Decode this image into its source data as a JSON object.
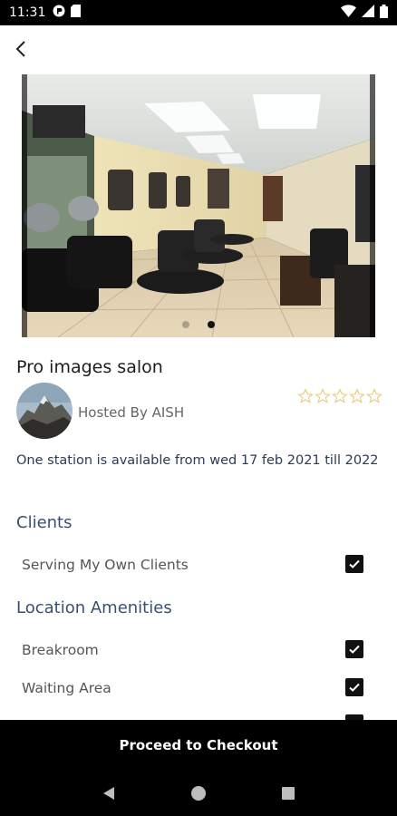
{
  "status_bar": {
    "time": "11:31",
    "icons_left": [
      "vpn-icon",
      "sd-card-icon"
    ],
    "icons_right": [
      "wifi-icon",
      "signal-icon",
      "battery-icon"
    ]
  },
  "listing": {
    "title": "Pro images salon",
    "host_text": "Hosted By AISH",
    "rating": 0,
    "rating_max": 5,
    "availability": "One station is available from wed 17 feb 2021 till 2022",
    "image_count": 2,
    "active_image_index": 1
  },
  "clients": {
    "title": "Clients",
    "items": [
      {
        "label": "Serving My Own Clients",
        "checked": true
      }
    ]
  },
  "amenities": {
    "title": "Location Amenities",
    "items": [
      {
        "label": "Breakroom",
        "checked": true
      },
      {
        "label": "Waiting Area",
        "checked": true
      }
    ]
  },
  "checkout": {
    "label": "Proceed to Checkout"
  },
  "nav": {
    "back": "back-icon",
    "home": "home-icon",
    "recents": "recents-icon"
  },
  "colors": {
    "section_title": "#3a5070",
    "availability": "#2b3a55",
    "star_outline": "#e8c87a"
  }
}
